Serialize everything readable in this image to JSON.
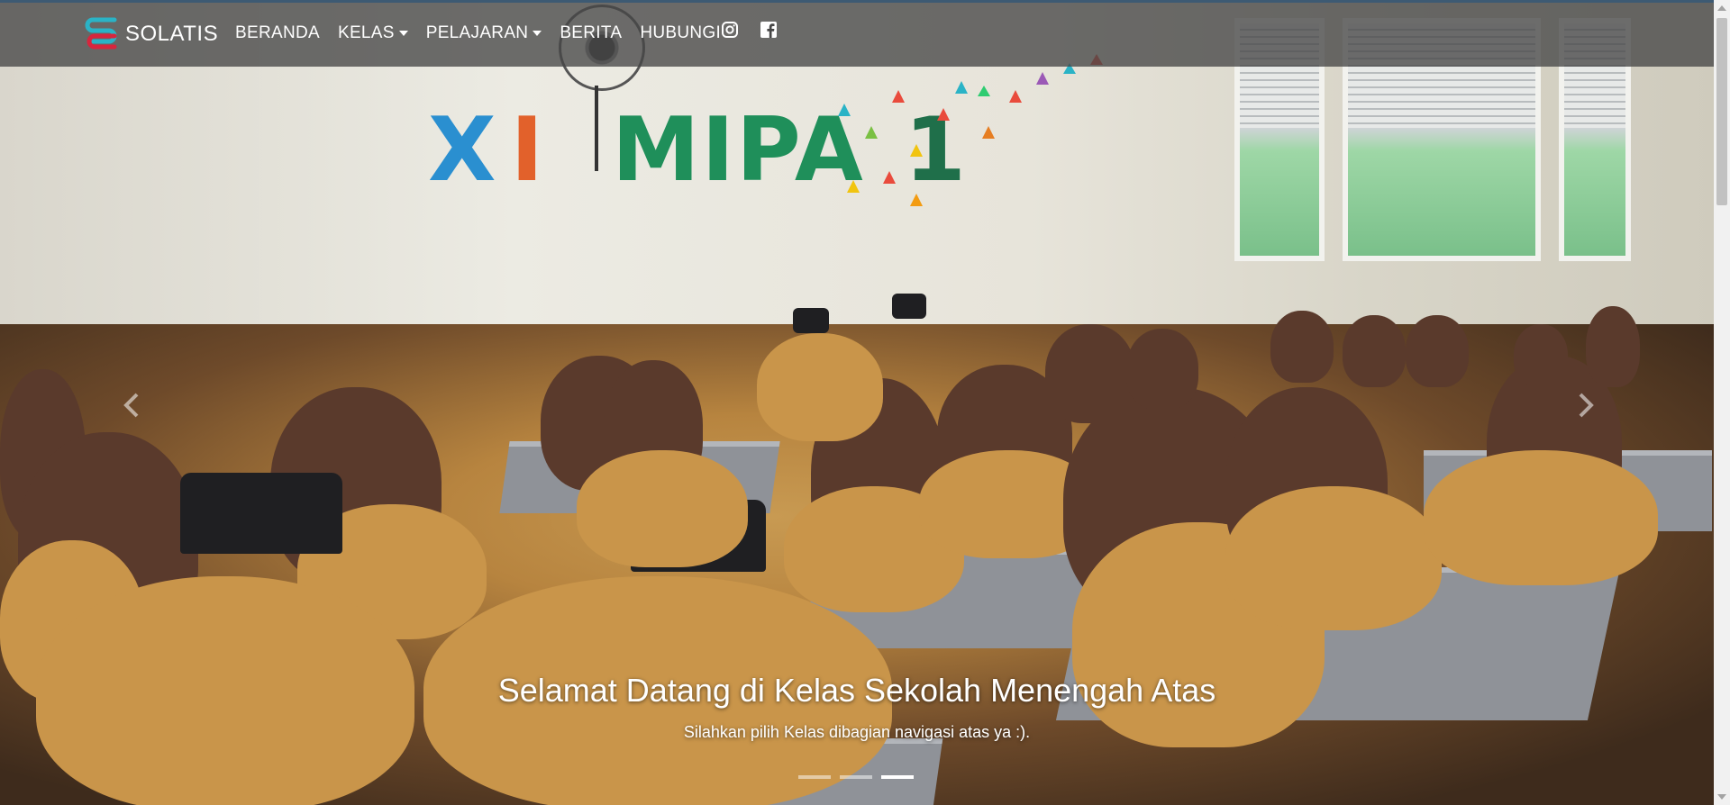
{
  "brand": {
    "name": "SOLATIS",
    "logo_icon": "solatis-logo-icon",
    "colors": [
      "#2ab3c6",
      "#d7263d"
    ]
  },
  "nav": {
    "items": [
      {
        "label": "BERANDA",
        "dropdown": false
      },
      {
        "label": "KELAS",
        "dropdown": true
      },
      {
        "label": "PELAJARAN",
        "dropdown": true
      },
      {
        "label": "BERITA",
        "dropdown": false
      },
      {
        "label": "HUBUNGI",
        "dropdown": false
      }
    ],
    "social": [
      "instagram-icon",
      "facebook-icon"
    ]
  },
  "hero": {
    "wall_text": [
      "X",
      "I",
      "MIPA",
      "1"
    ],
    "title": "Selamat Datang di Kelas Sekolah Menengah Atas",
    "subtitle": "Silahkan pilih Kelas dibagian navigasi atas ya :).",
    "slides": 3,
    "active_slide": 3
  },
  "colors": {
    "navbar": "#464646",
    "text": "#ffffff"
  }
}
